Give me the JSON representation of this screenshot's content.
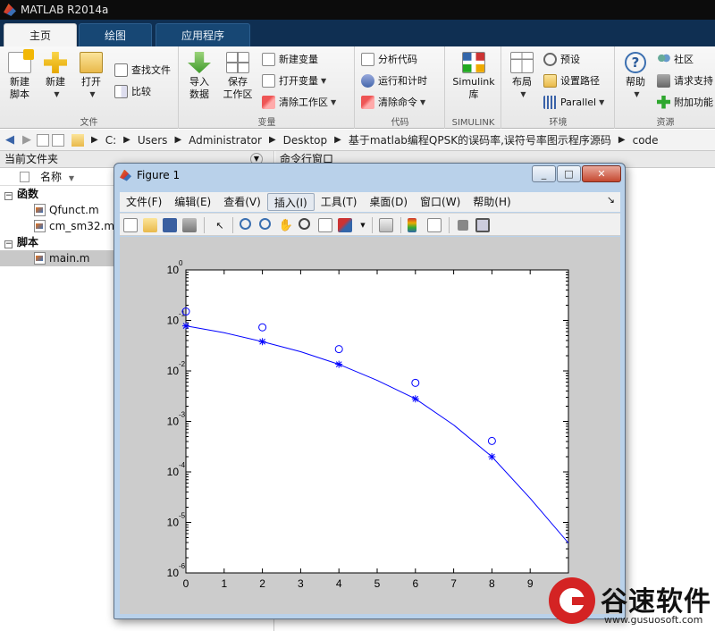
{
  "app": {
    "title": "MATLAB R2014a"
  },
  "tabs": [
    {
      "label": "主页",
      "active": true
    },
    {
      "label": "绘图",
      "active": false
    },
    {
      "label": "应用程序",
      "active": false
    }
  ],
  "ribbon": {
    "file": {
      "label": "文件",
      "new_script": "新建\n脚本",
      "new": "新建",
      "open": "打开",
      "find_files": "查找文件",
      "compare": "比较"
    },
    "variable": {
      "label": "变量",
      "import_data": "导入\n数据",
      "save_workspace": "保存\n工作区",
      "new_variable": "新建变量",
      "open_variable": "打开变量",
      "clear_workspace": "清除工作区"
    },
    "code": {
      "label": "代码",
      "analyze": "分析代码",
      "run_and_time": "运行和计时",
      "clear_commands": "清除命令"
    },
    "simulink": {
      "label": "SIMULINK",
      "library": "Simulink\n库"
    },
    "environment": {
      "label": "环境",
      "layout": "布局",
      "preferences": "预设",
      "set_path": "设置路径",
      "parallel": "Parallel"
    },
    "resources": {
      "label": "资源",
      "help": "帮助",
      "community": "社区",
      "request_support": "请求支持",
      "addons": "附加功能"
    }
  },
  "address": {
    "crumbs": [
      "C:",
      "Users",
      "Administrator",
      "Desktop",
      "基于matlab编程QPSK的误码率,误符号率图示程序源码",
      "code"
    ]
  },
  "current_folder": {
    "title": "当前文件夹",
    "name_column": "名称",
    "groups": [
      {
        "label": "函数",
        "files": [
          "Qfunct.m",
          "cm_sm32.m"
        ]
      },
      {
        "label": "脚本",
        "files": [
          "main.m"
        ]
      }
    ],
    "selected": "main.m"
  },
  "command_window": {
    "title": "命令行窗口"
  },
  "figure": {
    "title": "Figure 1",
    "menus": [
      "文件(F)",
      "编辑(E)",
      "查看(V)",
      "插入(I)",
      "工具(T)",
      "桌面(D)",
      "窗口(W)",
      "帮助(H)"
    ],
    "active_menu": "插入(I)",
    "toolbar_icons": [
      "new-figure-icon",
      "open-icon",
      "save-icon",
      "print-icon",
      "pointer-icon",
      "zoom-in-icon",
      "zoom-out-icon",
      "pan-icon",
      "rotate-icon",
      "data-cursor-icon",
      "brush-icon",
      "link-icon",
      "colorbar-icon",
      "legend-icon",
      "hide-plot-tools-icon",
      "show-plot-tools-icon"
    ]
  },
  "watermark": {
    "name": "谷速软件",
    "url": "www.gusuosoft.com"
  },
  "chart_data": {
    "type": "scatter",
    "title": "",
    "xlabel": "",
    "ylabel": "",
    "xlim": [
      0,
      10
    ],
    "ylim": [
      1e-06,
      1
    ],
    "yscale": "log",
    "x_ticks": [
      "0",
      "1",
      "2",
      "3",
      "4",
      "5",
      "6",
      "7",
      "8",
      "9",
      "10"
    ],
    "y_ticks": [
      {
        "base": "10",
        "exp": "0"
      },
      {
        "base": "10",
        "exp": "-1"
      },
      {
        "base": "10",
        "exp": "-2"
      },
      {
        "base": "10",
        "exp": "-3"
      },
      {
        "base": "10",
        "exp": "-4"
      },
      {
        "base": "10",
        "exp": "-5"
      },
      {
        "base": "10",
        "exp": "-6"
      }
    ],
    "color": "#0000ff",
    "grid": false,
    "series": [
      {
        "marker": "circle",
        "x": [
          0,
          2,
          4,
          6,
          8
        ],
        "y": [
          0.15,
          0.073,
          0.027,
          0.0058,
          0.00041
        ]
      },
      {
        "marker": "star",
        "x": [
          0,
          2,
          4,
          6,
          8
        ],
        "y": [
          0.078,
          0.038,
          0.0135,
          0.0028,
          0.0002
        ]
      },
      {
        "marker": "line",
        "x": [
          0,
          1,
          2,
          3,
          4,
          5,
          6,
          7,
          8,
          9,
          10
        ],
        "y": [
          0.078,
          0.057,
          0.038,
          0.024,
          0.0135,
          0.0065,
          0.0028,
          0.00085,
          0.0002,
          3e-05,
          3.9e-06
        ]
      }
    ]
  }
}
